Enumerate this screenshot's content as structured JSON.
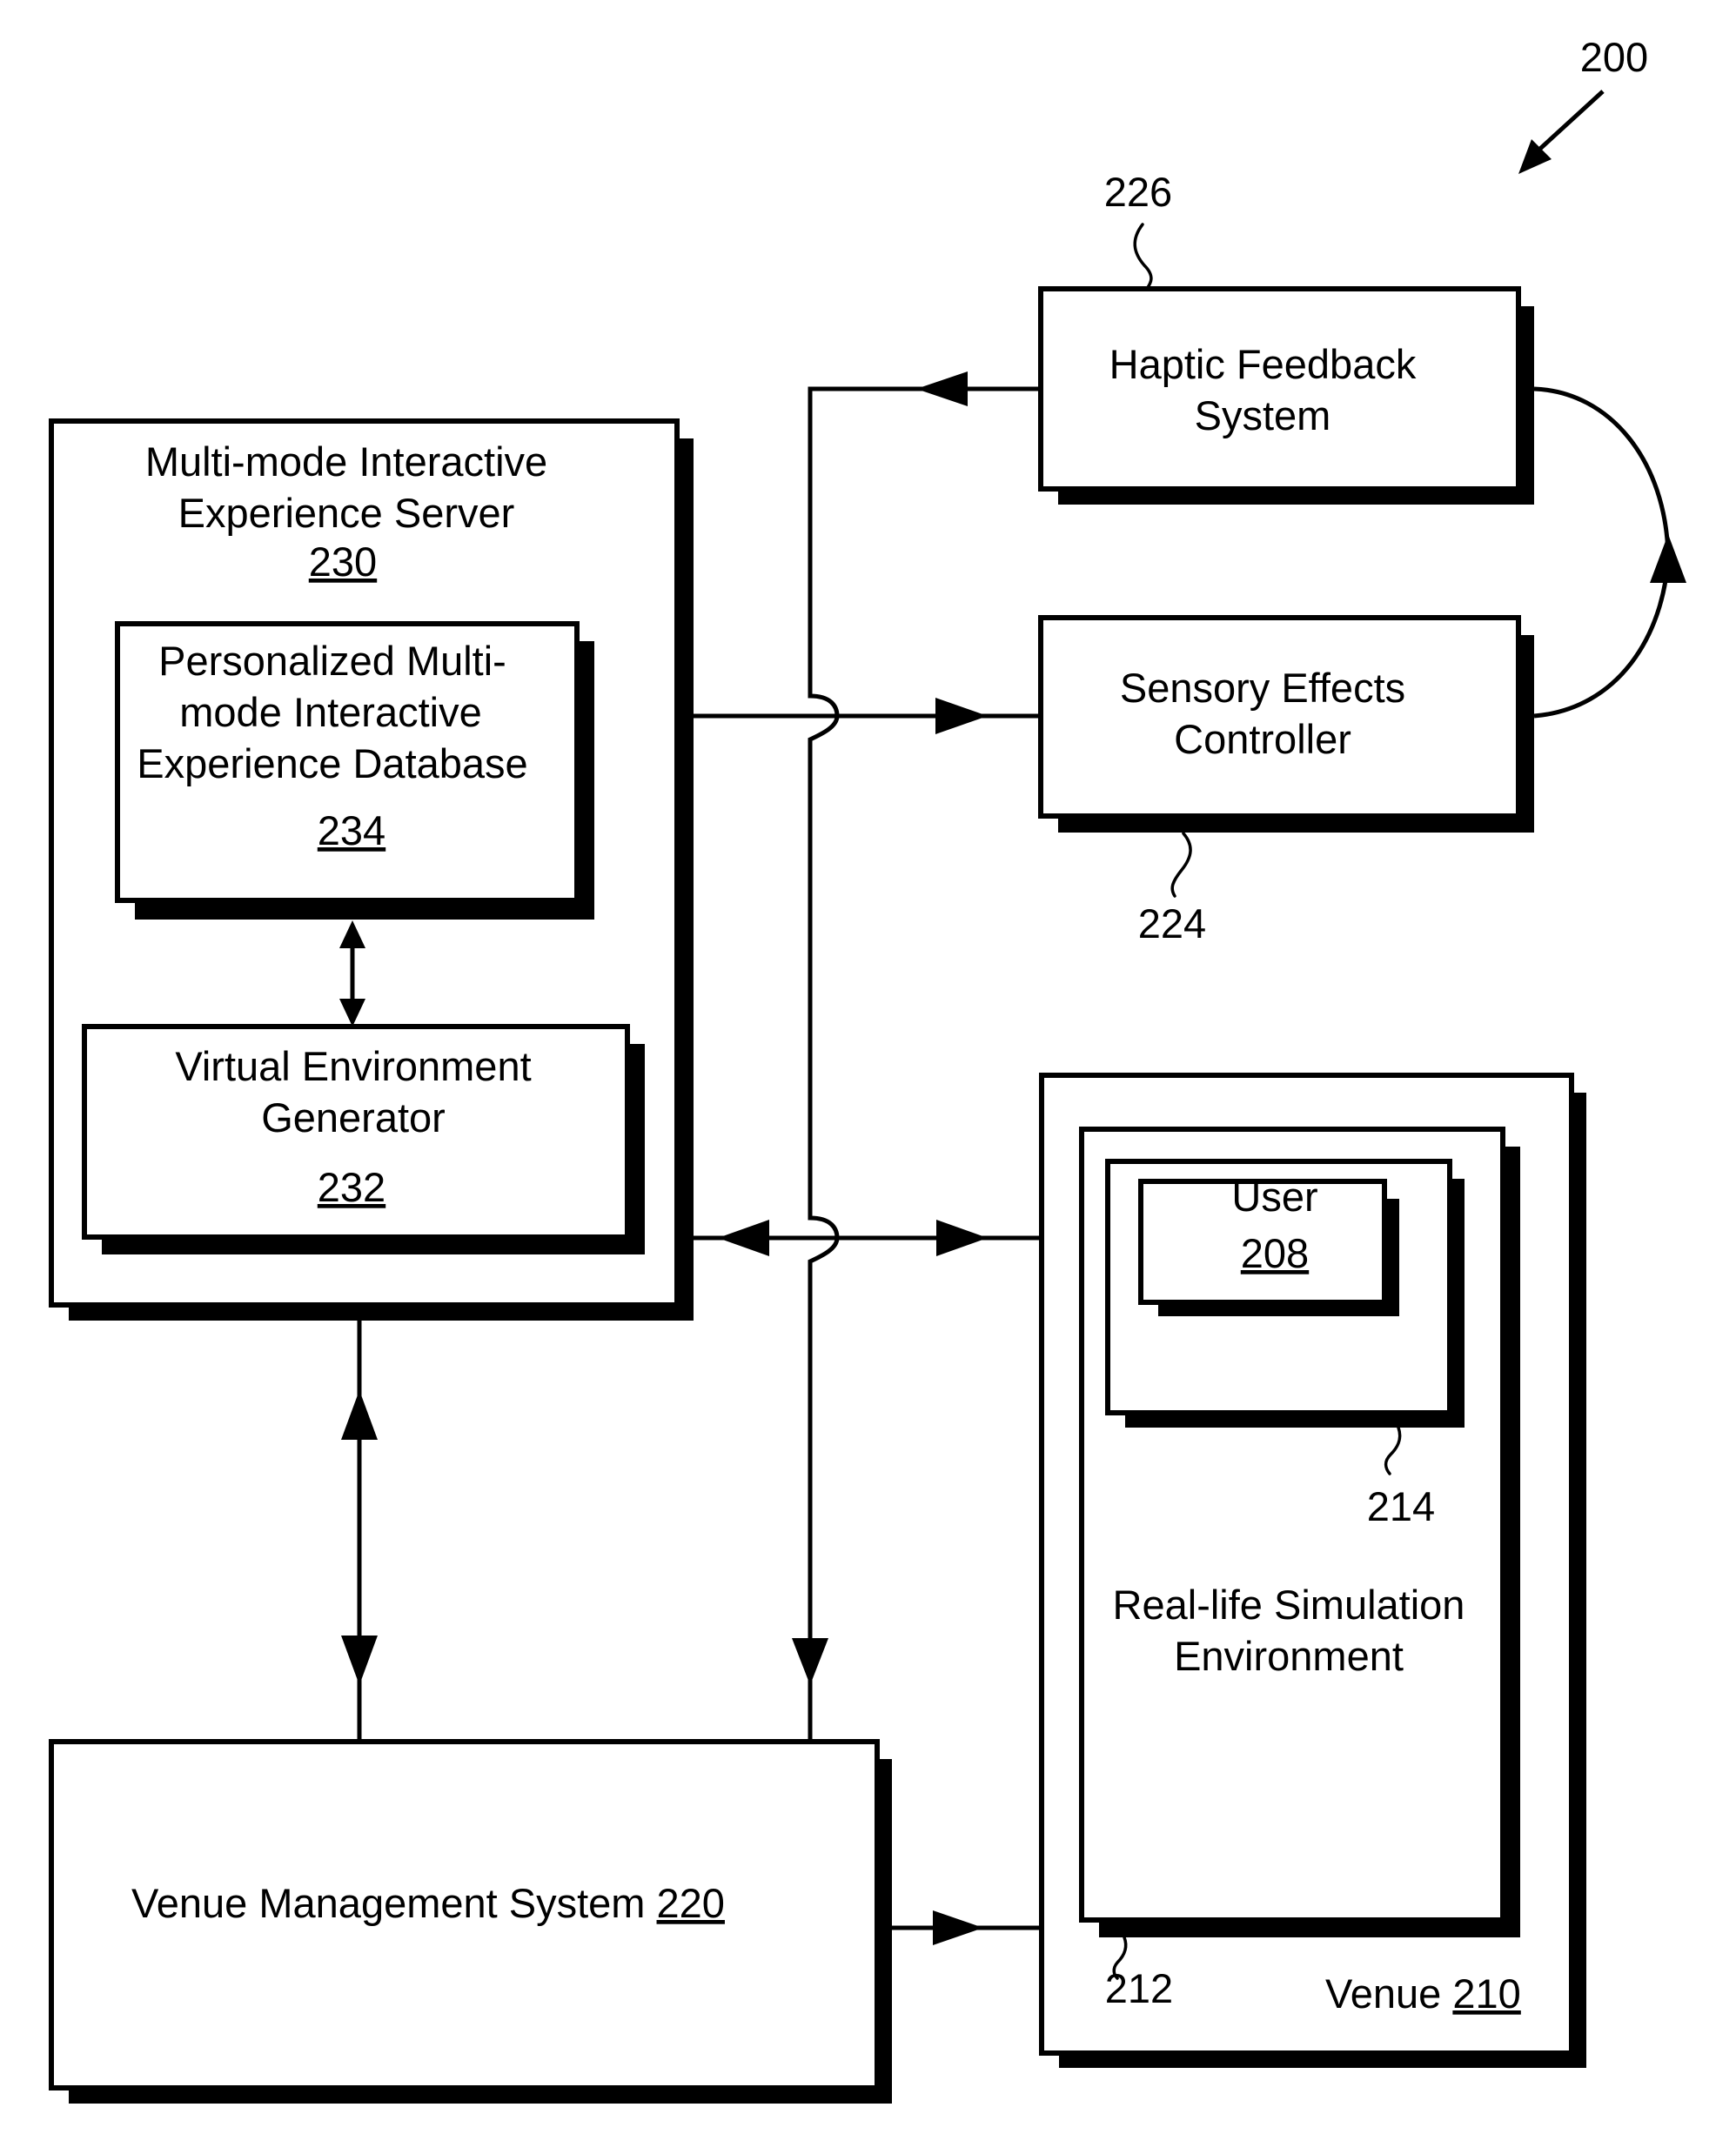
{
  "figure": {
    "number": "200",
    "colors": {
      "ink": "#000000",
      "paper": "#ffffff"
    }
  },
  "server": {
    "title_lines": [
      "Multi-mode Interactive",
      "Experience Server"
    ],
    "ref": "230",
    "database": {
      "title_lines": [
        "Personalized Multi-",
        "mode Interactive",
        "Experience Database"
      ],
      "ref": "234"
    },
    "generator": {
      "title_lines": [
        "Virtual Environment",
        "Generator"
      ],
      "ref": "232"
    }
  },
  "haptic": {
    "title_lines": [
      "Haptic Feedback",
      "System"
    ],
    "ref": "226"
  },
  "sensory": {
    "title_lines": [
      "Sensory Effects",
      "Controller"
    ],
    "ref": "224"
  },
  "venue_management": {
    "title": "Venue Management System",
    "ref": "220"
  },
  "venue": {
    "title": "Venue",
    "ref": "210",
    "environment": {
      "title_lines": [
        "Real-life Simulation",
        "Environment"
      ],
      "ref": "212"
    },
    "zone": {
      "ref": "214"
    },
    "user": {
      "title": "User",
      "ref": "208"
    }
  },
  "connections": [
    {
      "from": "haptic",
      "to": "bus",
      "direction": "left"
    },
    {
      "from": "server",
      "to": "sensory",
      "direction": "right"
    },
    {
      "from": "sensory",
      "to": "haptic",
      "direction": "curved-up"
    },
    {
      "from": "server",
      "to": "user",
      "direction": "bidirectional"
    },
    {
      "from": "database",
      "to": "generator",
      "direction": "bidirectional"
    },
    {
      "from": "server",
      "to": "venue_management",
      "direction": "bidirectional"
    },
    {
      "from": "bus",
      "to": "venue_management",
      "direction": "down"
    },
    {
      "from": "venue_management",
      "to": "venue",
      "direction": "right"
    }
  ]
}
